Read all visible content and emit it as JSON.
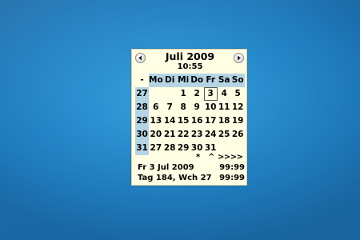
{
  "desktop": {
    "background_color": "#2a8fd0"
  },
  "calendar": {
    "month_title": "Juli 2009",
    "time": "10:55",
    "prev_icon": "left-arrow-circle-icon",
    "next_icon": "right-arrow-circle-icon",
    "week_header": "-",
    "weekdays": [
      "Mo",
      "Di",
      "Mi",
      "Do",
      "Fr",
      "Sa",
      "So"
    ],
    "weeks": [
      {
        "week": "27",
        "days": [
          "",
          "",
          "1",
          "2",
          "3",
          "4",
          "5"
        ]
      },
      {
        "week": "28",
        "days": [
          "6",
          "7",
          "8",
          "9",
          "10",
          "11",
          "12"
        ]
      },
      {
        "week": "29",
        "days": [
          "13",
          "14",
          "15",
          "16",
          "17",
          "18",
          "19"
        ]
      },
      {
        "week": "30",
        "days": [
          "20",
          "21",
          "22",
          "23",
          "24",
          "25",
          "26"
        ]
      },
      {
        "week": "31",
        "days": [
          "27",
          "28",
          "29",
          "30",
          "31",
          "",
          ""
        ]
      }
    ],
    "today": "3",
    "header_bg_color": "#b5d5e5",
    "panel_bg_color": "#fffde3",
    "controls": {
      "star": "*",
      "up": "^",
      "forward": ">>>>"
    },
    "info": {
      "date_line": "Fr 3 Jul 2009",
      "date_value": "99:99",
      "day_line": "Tag 184, Wch 27",
      "day_value": "99:99"
    }
  }
}
